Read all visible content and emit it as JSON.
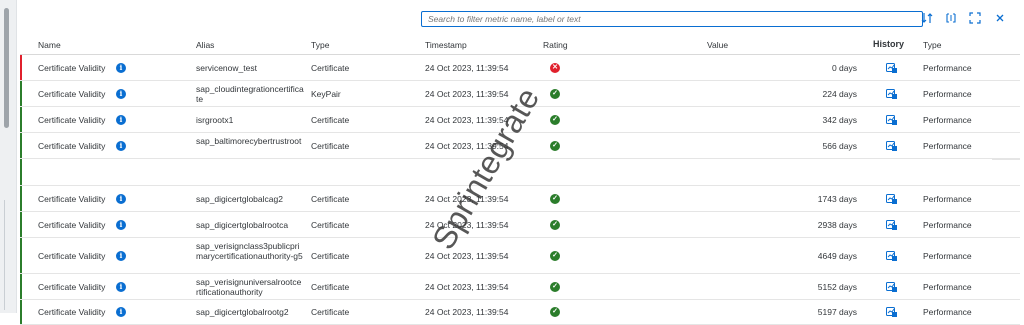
{
  "search": {
    "placeholder": "Search to filter metric name, label or text",
    "value": ""
  },
  "toolbar": {
    "icons": [
      "sort-icon",
      "filter-icon",
      "fullscreen-icon",
      "close-icon"
    ]
  },
  "columns": {
    "name": "Name",
    "alias": "Alias",
    "type": "Type",
    "timestamp": "Timestamp",
    "rating": "Rating",
    "value": "Value",
    "history": "History",
    "type2": "Type"
  },
  "rows": [
    {
      "name": "Certificate Validity",
      "alias": "servicenow_test",
      "type": "Certificate",
      "timestamp": "24 Oct 2023, 11:39:54",
      "rating": "error",
      "value": "0 days",
      "type2": "Performance"
    },
    {
      "name": "Certificate Validity",
      "alias": "sap_cloudintegrationcertificate",
      "type": "KeyPair",
      "timestamp": "24 Oct 2023, 11:39:54",
      "rating": "success",
      "value": "224 days",
      "type2": "Performance"
    },
    {
      "name": "Certificate Validity",
      "alias": "isrgrootx1",
      "type": "Certificate",
      "timestamp": "24 Oct 2023, 11:39:54",
      "rating": "success",
      "value": "342 days",
      "type2": "Performance"
    },
    {
      "name": "Certificate Validity",
      "alias": "sap_baltimorecybertrustroot",
      "type": "Certificate",
      "timestamp": "24 Oct 2023, 11:39:54",
      "rating": "success",
      "value": "566 days",
      "type2": "Performance"
    },
    {
      "name": "Certificate Validity",
      "alias": "sap_digicertglobalcag2",
      "type": "Certificate",
      "timestamp": "24 Oct 2023, 11:39:54",
      "rating": "success",
      "value": "1743 days",
      "type2": "Performance"
    },
    {
      "name": "Certificate Validity",
      "alias": "sap_digicertglobalrootca",
      "type": "Certificate",
      "timestamp": "24 Oct 2023, 11:39:54",
      "rating": "success",
      "value": "2938 days",
      "type2": "Performance"
    },
    {
      "name": "Certificate Validity",
      "alias": "sap_verisignclass3publicprimarycertificationauthority-g5",
      "type": "Certificate",
      "timestamp": "24 Oct 2023, 11:39:54",
      "rating": "success",
      "value": "4649 days",
      "type2": "Performance"
    },
    {
      "name": "Certificate Validity",
      "alias": "sap_verisignuniversalrootcertificationauthority",
      "type": "Certificate",
      "timestamp": "24 Oct 2023, 11:39:54",
      "rating": "success",
      "value": "5152 days",
      "type2": "Performance"
    },
    {
      "name": "Certificate Validity",
      "alias": "sap_digicertglobalrootg2",
      "type": "Certificate",
      "timestamp": "24 Oct 2023, 11:39:54",
      "rating": "success",
      "value": "5197 days",
      "type2": "Performance"
    }
  ],
  "watermark": "Sprintegrate",
  "colors": {
    "accent": "#0a6ed1",
    "success": "#2b7d2b",
    "error": "#e0202c"
  }
}
